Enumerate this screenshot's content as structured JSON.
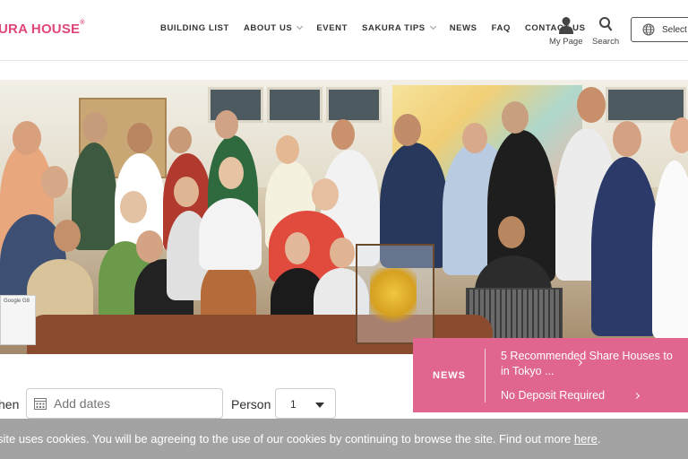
{
  "header": {
    "logo": "URA HOUSE",
    "logo_mark": "®",
    "nav": [
      {
        "label": "BUILDING LIST",
        "dropdown": false
      },
      {
        "label": "ABOUT US",
        "dropdown": true
      },
      {
        "label": "EVENT",
        "dropdown": false
      },
      {
        "label": "SAKURA TIPS",
        "dropdown": true
      },
      {
        "label": "NEWS",
        "dropdown": false
      },
      {
        "label": "FAQ",
        "dropdown": false
      },
      {
        "label": "CONTACT US",
        "dropdown": false
      }
    ],
    "mypage_label": "My Page",
    "search_label": "Search",
    "language_label": "Select",
    "icons": {
      "mypage": "user-icon",
      "search": "search-icon",
      "language": "globe-icon"
    }
  },
  "hero": {
    "sign_text": "Google G8"
  },
  "news": {
    "label": "NEWS",
    "title": "5 Recommended Share Houses to",
    "title_line2": "in Tokyo ...",
    "subtitle": "No Deposit Required"
  },
  "search_bar": {
    "when_label": "hen",
    "dates_placeholder": "Add dates",
    "person_label": "Person",
    "person_value": "1"
  },
  "cookie": {
    "text": "site uses cookies. You will be agreeing to the use of our cookies by continuing to browse the site. Find out more ",
    "link": "here",
    "end": "."
  },
  "colors": {
    "brand": "#e0457b",
    "news_bg": "#e0668f",
    "cookie_bg": "#a3a3a3"
  }
}
